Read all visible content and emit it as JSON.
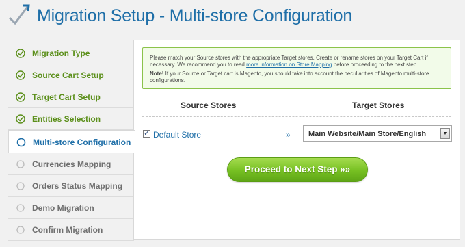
{
  "header": {
    "title": "Migration Setup - Multi-store Configuration",
    "logo_icon": "check-arrow-icon"
  },
  "sidebar": {
    "steps": [
      {
        "label": "Migration Type",
        "status": "done"
      },
      {
        "label": "Source Cart Setup",
        "status": "done"
      },
      {
        "label": "Target Cart Setup",
        "status": "done"
      },
      {
        "label": "Entities Selection",
        "status": "done"
      },
      {
        "label": "Multi-store Configuration",
        "status": "active"
      },
      {
        "label": "Currencies Mapping",
        "status": "pending"
      },
      {
        "label": "Orders Status Mapping",
        "status": "pending"
      },
      {
        "label": "Demo Migration",
        "status": "pending"
      },
      {
        "label": "Confirm Migration",
        "status": "pending"
      }
    ]
  },
  "notice": {
    "text_before_link": "Please match your Source stores with the appropriate Target stores. Create or rename stores on your Target Cart if necessary. We recommend you to read ",
    "link_text": "more information on Store Mapping",
    "text_after_link": " before proceeding to the next step.",
    "note_label": "Note!",
    "note_text": " If your Source or Target cart is Magento, you should take into account the peculiarities of Magento multi-store configurations."
  },
  "columns": {
    "source": "Source Stores",
    "target": "Target Stores"
  },
  "mapping": {
    "source_store": "Default Store",
    "checked": true,
    "arrow": "»",
    "target_selected": "Main Website/Main Store/English"
  },
  "actions": {
    "next_label": "Proceed to Next Step »»"
  },
  "colors": {
    "accent": "#1f6fa8",
    "done": "#5b8f1a",
    "button_green": "#76c022",
    "notice_bg": "#f2fbe9",
    "notice_border": "#8bc34a"
  }
}
